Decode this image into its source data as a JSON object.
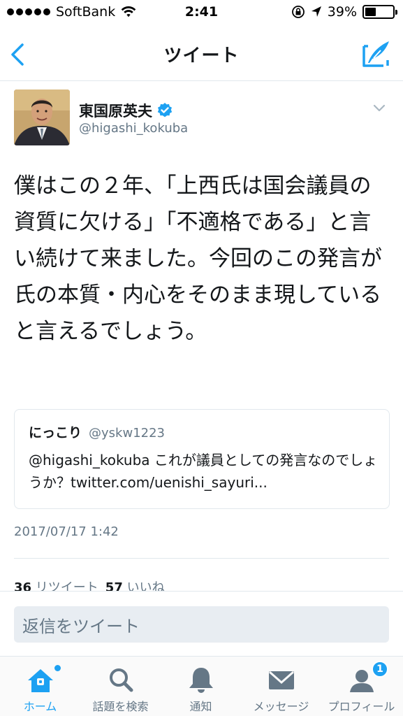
{
  "status_bar": {
    "carrier": "SoftBank",
    "time": "2:41",
    "battery": "39%",
    "battery_level": 0.39
  },
  "nav": {
    "title": "ツイート"
  },
  "tweet": {
    "author_name": "東国原英夫",
    "author_handle": "@higashi_kokuba",
    "text": "僕はこの２年、「上西氏は国会議員の資質に欠ける」「不適格である」と言い続けて来ました。今回のこの発言が氏の本質・内心をそのまま現していると言えるでしょう。",
    "timestamp": "2017/07/17 1:42",
    "retweets": "36",
    "retweets_label": "リツイート",
    "likes": "57",
    "likes_label": "いいね"
  },
  "quote": {
    "name": "にっこり",
    "handle": "@yskw1223",
    "text": "@higashi_kokuba これが議員としての発言なのでしょうか？twitter.com/uenishi_sayuri..."
  },
  "reply": {
    "placeholder": "返信をツイート"
  },
  "tabs": [
    {
      "label": "ホーム",
      "icon": "home-icon",
      "active": true
    },
    {
      "label": "話題を検索",
      "icon": "search-icon"
    },
    {
      "label": "通知",
      "icon": "bell-icon"
    },
    {
      "label": "メッセージ",
      "icon": "envelope-icon"
    },
    {
      "label": "プロフィール",
      "icon": "profile-icon",
      "badge": "1"
    }
  ],
  "colors": {
    "accent": "#1da1f2",
    "secondary_text": "#657786",
    "border": "#e1e8ed"
  }
}
